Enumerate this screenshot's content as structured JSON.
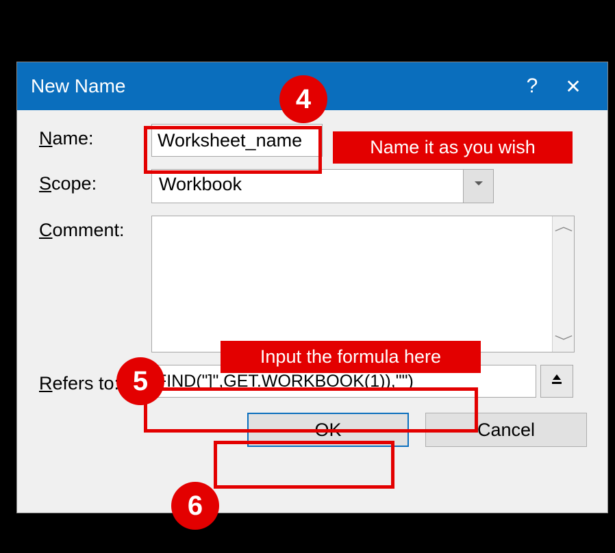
{
  "dialog": {
    "title": "New Name",
    "labels": {
      "name": "Name:",
      "scope": "Scope:",
      "comment": "Comment:",
      "refers_to": "Refers to:"
    },
    "fields": {
      "name_value": "Worksheet_name",
      "scope_value": "Workbook",
      "comment_value": "",
      "refers_to_value": "FIND(\"]\",GET.WORKBOOK(1)),\"\")"
    },
    "buttons": {
      "ok": "OK",
      "cancel": "Cancel"
    },
    "titlebar": {
      "help": "?",
      "close": "✕"
    },
    "collapse_icon": "⬆"
  },
  "annotations": {
    "badge4": "4",
    "callout4": "Name it as you wish",
    "badge5": "5",
    "callout5": "Input the formula here",
    "badge6": "6"
  }
}
